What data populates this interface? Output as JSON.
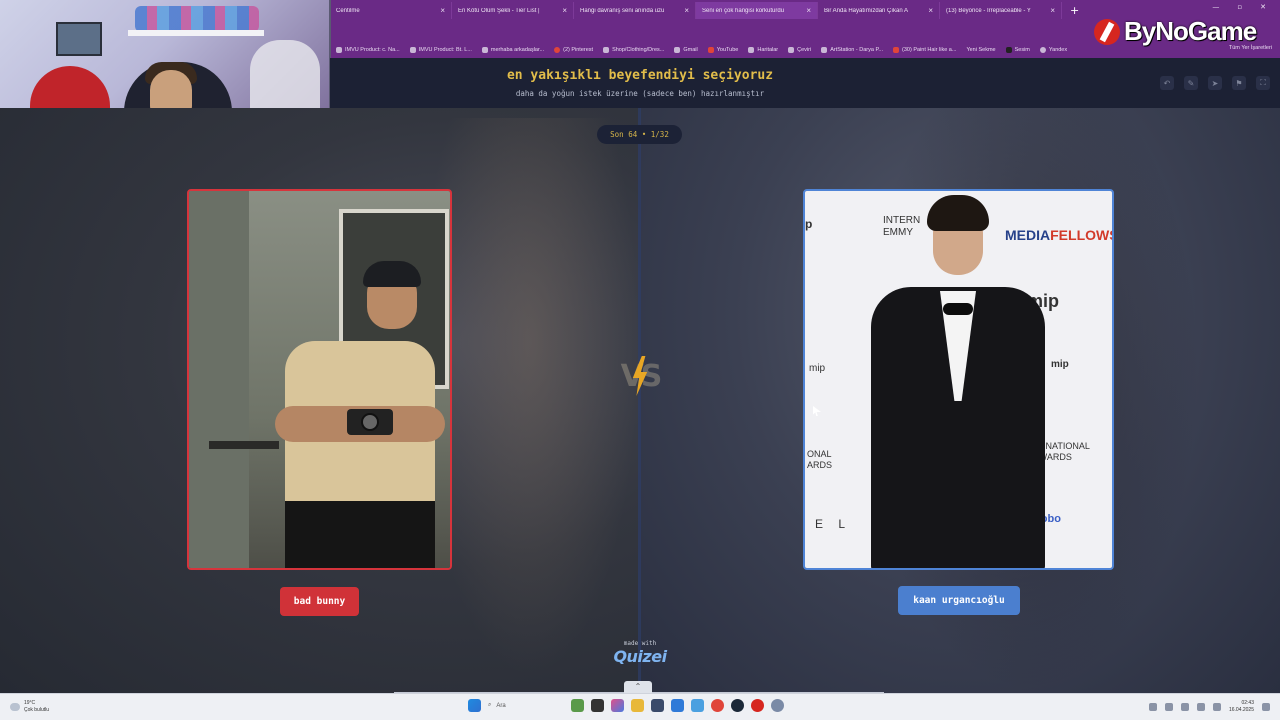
{
  "browser": {
    "tabs": [
      {
        "title": "Centilme"
      },
      {
        "title": "En Kötü Ölüm Şekli - Tier List |"
      },
      {
        "title": "Hangi davranış seni anında uzu"
      },
      {
        "title": "Seni en çok hangisi korkuturdu"
      },
      {
        "title": "Bir Anda Hayatımızdan Çıkan A"
      },
      {
        "title": "(13) Beyoncé - Irreplaceable - Y"
      }
    ],
    "new_tab": "+",
    "bookmarks": [
      "IMVU Product: c. Na...",
      "IMVU Product: Bt. L...",
      "merhaba arkadaşlar...",
      "(2) Pinterest",
      "Shop/Clothing/Dres...",
      "Gmail",
      "YouTube",
      "Haritalar",
      "Çeviri",
      "ArtStation - Darya P...",
      "(30) Paint Hair like a...",
      "Yeni Sekme",
      "Sesim",
      "Yandex"
    ],
    "all_bookmarks": "Tüm Yer İşaretleri",
    "brand": "ByNoGame"
  },
  "app": {
    "title": "en yakışıklı beyefendiyi seçiyoruz",
    "subtitle": "daha da yoğun istek üzerine (sadece ben) hazırlanmıştır",
    "round_label": "Son 64 • 1/32",
    "vs_label": "VS",
    "left_choice": "bad bunny",
    "right_choice": "kaan urgancıoğlu",
    "made_with_small": "made with",
    "made_with_logo": "Quizei",
    "accent_left": "#d03238",
    "accent_right": "#4b7fcf",
    "title_color": "#e2bd4a"
  },
  "right_photo_text": {
    "media": "MEDIA",
    "fellows": "FELLOWS",
    "intl": "INTERN\nEMMY",
    "mip": "mip",
    "mip_small": "mip",
    "mip_left": "mip",
    "awards_right": "ERNATIONAL\nAWARDS",
    "awards_left": "ONAL\nARDS",
    "el": "E L",
    "globo": "globo",
    "p": "p"
  },
  "taskbar": {
    "weather_temp": "19°C",
    "weather_desc": "Çok bulutlu",
    "search_placeholder": "Ara",
    "time": "02:43",
    "date": "16.04.2025"
  },
  "icons": {
    "header": [
      "undo-icon",
      "edit-icon",
      "share-icon",
      "flag-icon",
      "fullscreen-icon"
    ]
  }
}
